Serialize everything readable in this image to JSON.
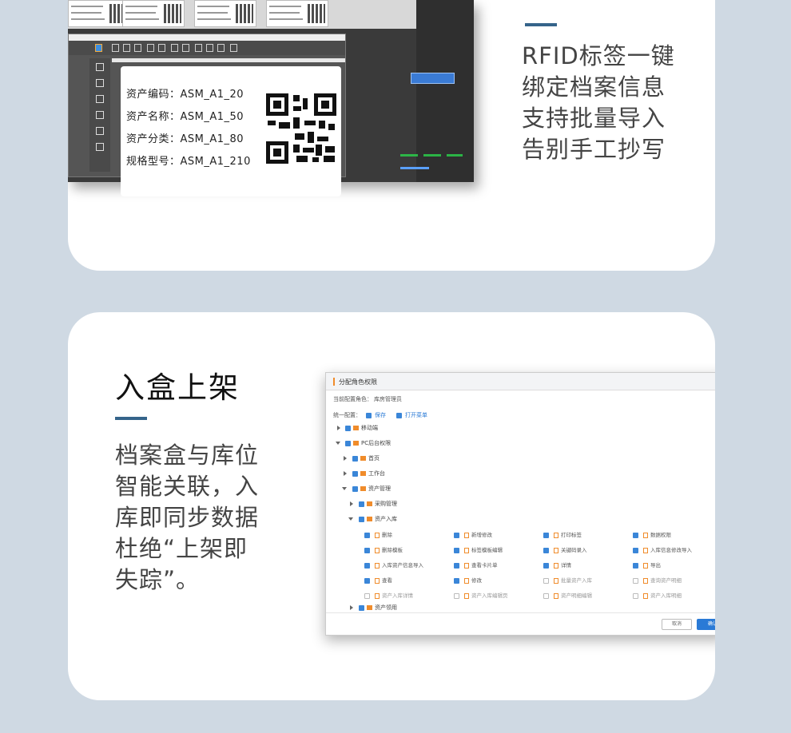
{
  "colors": {
    "background": "#cfd9e3",
    "card": "#ffffff",
    "accent": "#35648a",
    "checkbox": "#3a86d8",
    "folder": "#f08c2b"
  },
  "top": {
    "paragraph": [
      "RFID标签一键",
      "绑定档案信息",
      "支持批量导入",
      "告别手工抄写"
    ],
    "label": [
      "资产编码：ASM_A1_20",
      "资产名称：ASM_A1_50",
      "资产分类：ASM_A1_80",
      "规格型号：ASM_A1_210"
    ]
  },
  "bottom": {
    "title": "入盒上架",
    "paragraph": [
      "档案盒与库位",
      "智能关联，入",
      "库即同步数据",
      "杜绝“上架即",
      "失踪”。"
    ],
    "dialog": {
      "title": "分配角色权限",
      "role_label": "当前配置角色：",
      "role_value": "库房管理员",
      "ops_label": "统一配置：",
      "ops": [
        "保存",
        "打开菜单"
      ],
      "tree": [
        {
          "label": "移动端",
          "level": 0,
          "state": "collapsed"
        },
        {
          "label": "PC后台权限",
          "level": 0,
          "state": "expanded"
        },
        {
          "label": "首页",
          "level": 1,
          "state": "collapsed"
        },
        {
          "label": "工作台",
          "level": 1,
          "state": "collapsed"
        },
        {
          "label": "资产管理",
          "level": 1,
          "state": "expanded"
        },
        {
          "label": "采购管理",
          "level": 2,
          "state": "collapsed"
        },
        {
          "label": "资产入库",
          "level": 2,
          "state": "expanded"
        }
      ],
      "permissions": [
        [
          "删除",
          "新增修改",
          "打印标签",
          "数据权限"
        ],
        [
          "删除模板",
          "标签模板编辑",
          "关键码录入",
          "入库信息修改导入"
        ],
        [
          "入库资产信息导入",
          "查看卡片单",
          "详情",
          "导出"
        ],
        [
          "查看",
          "修改",
          "批量资产入库",
          "查询资产明细"
        ],
        [
          "资产入库详情",
          "资产入库编辑页",
          "资产明细编辑",
          "资产入库明细"
        ]
      ],
      "last_node": "资产领用",
      "cancel": "取消",
      "confirm": "确认"
    }
  }
}
